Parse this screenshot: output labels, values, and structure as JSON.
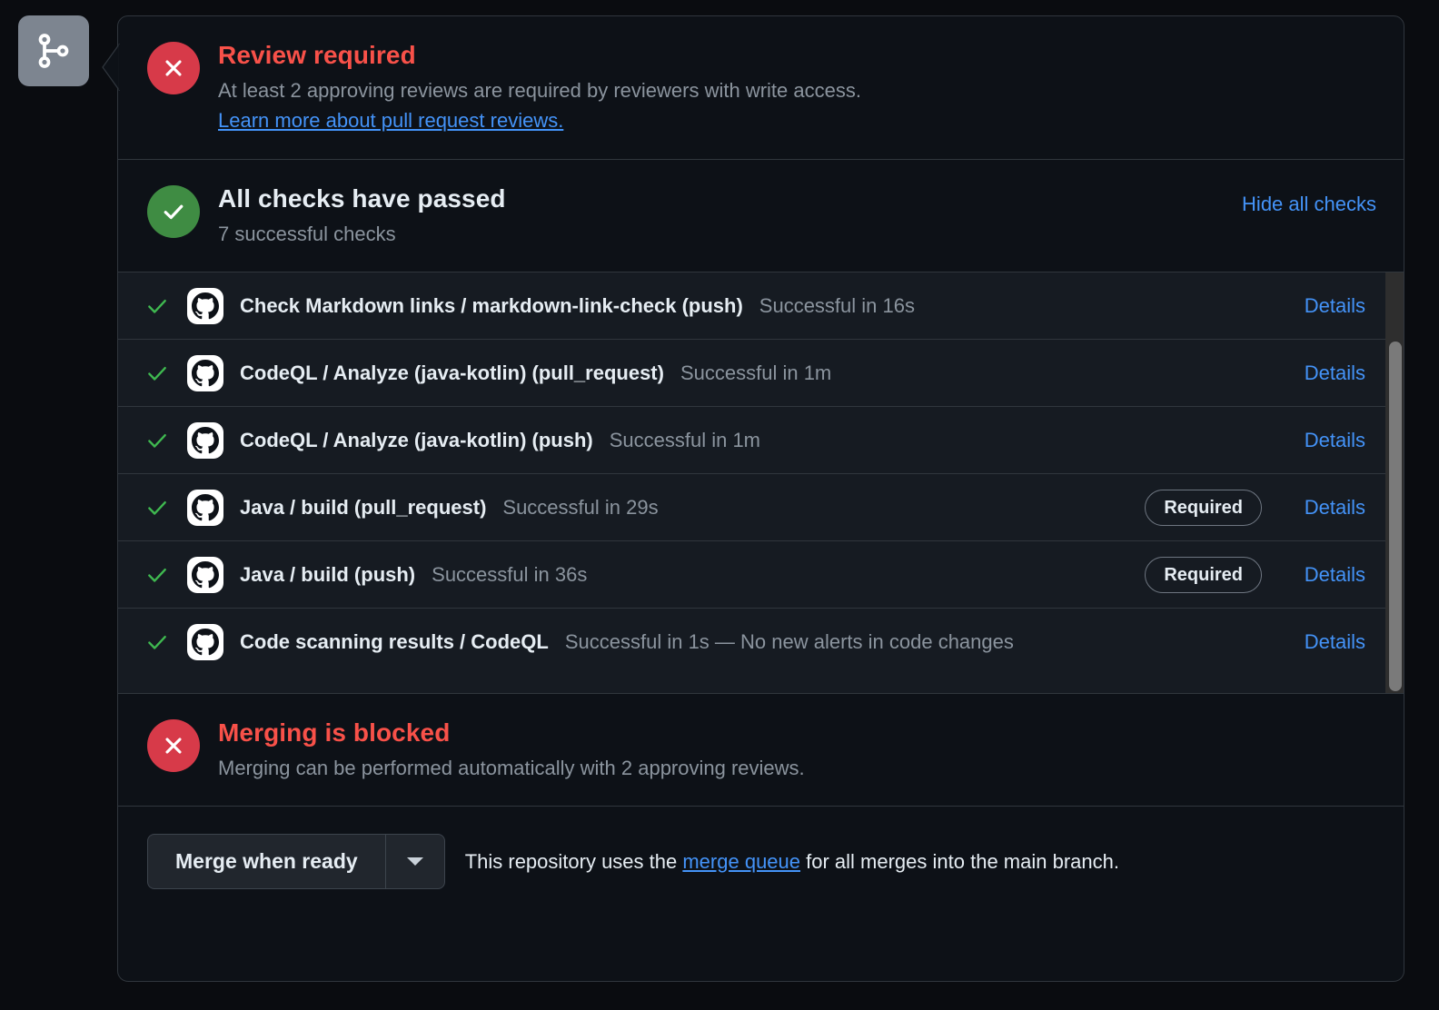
{
  "branch_badge": {
    "icon": "git-branch-icon"
  },
  "review": {
    "icon": "x-circle-icon",
    "title": "Review required",
    "description": "At least 2 approving reviews are required by reviewers with write access.",
    "link_label": "Learn more about pull request reviews."
  },
  "checks_header": {
    "icon": "check-circle-icon",
    "title": "All checks have passed",
    "subtitle": "7 successful checks",
    "toggle_label": "Hide all checks"
  },
  "checks": [
    {
      "status_icon": "check-icon",
      "avatar_icon": "github-octocat-icon",
      "name": "Check Markdown links / markdown-link-check (push)",
      "status": "Successful in 16s",
      "required": null,
      "details_label": "Details"
    },
    {
      "status_icon": "check-icon",
      "avatar_icon": "github-octocat-icon",
      "name": "CodeQL / Analyze (java-kotlin) (pull_request)",
      "status": "Successful in 1m",
      "required": null,
      "details_label": "Details"
    },
    {
      "status_icon": "check-icon",
      "avatar_icon": "github-octocat-icon",
      "name": "CodeQL / Analyze (java-kotlin) (push)",
      "status": "Successful in 1m",
      "required": null,
      "details_label": "Details"
    },
    {
      "status_icon": "check-icon",
      "avatar_icon": "github-octocat-icon",
      "name": "Java / build (pull_request)",
      "status": "Successful in 29s",
      "required": "Required",
      "details_label": "Details"
    },
    {
      "status_icon": "check-icon",
      "avatar_icon": "github-octocat-icon",
      "name": "Java / build (push)",
      "status": "Successful in 36s",
      "required": "Required",
      "details_label": "Details"
    },
    {
      "status_icon": "check-icon",
      "avatar_icon": "github-octocat-icon",
      "name": "Code scanning results / CodeQL",
      "status": "Successful in 1s — No new alerts in code changes",
      "required": null,
      "details_label": "Details"
    }
  ],
  "blocked": {
    "icon": "x-circle-icon",
    "title": "Merging is blocked",
    "description": "Merging can be performed automatically with 2 approving reviews."
  },
  "footer": {
    "merge_button_label": "Merge when ready",
    "dropdown_icon": "chevron-down-icon",
    "note_prefix": "This repository uses the ",
    "note_link": "merge queue",
    "note_suffix": " for all merges into the main branch."
  },
  "colors": {
    "danger": "#f85149",
    "success": "#3f8c43",
    "link": "#4493f8",
    "panel_bg": "#0d1117",
    "list_bg": "#161b22",
    "border": "#30363d",
    "muted_text": "#8b949e"
  }
}
